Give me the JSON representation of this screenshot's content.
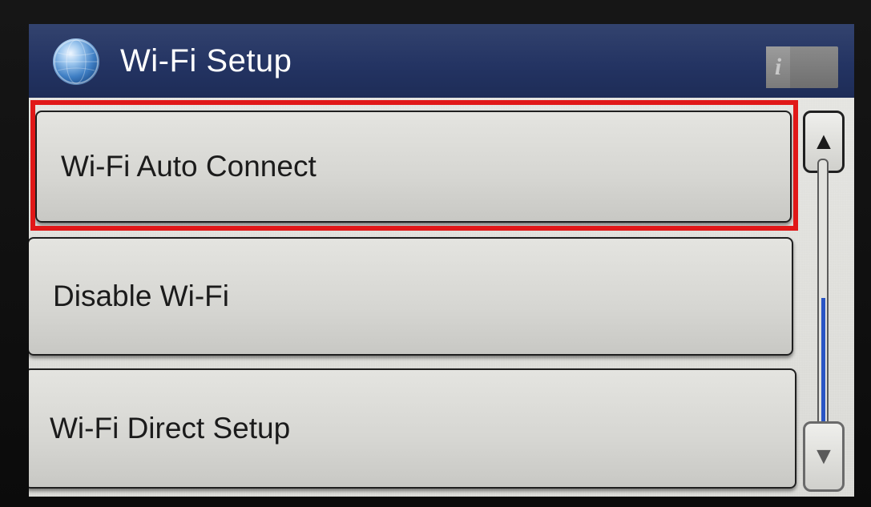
{
  "header": {
    "title": "Wi-Fi Setup",
    "globe_icon": "globe-icon",
    "info_label": "i"
  },
  "menu": {
    "items": [
      {
        "label": "Wi-Fi Auto Connect",
        "selected": true
      },
      {
        "label": "Disable Wi-Fi",
        "selected": false
      },
      {
        "label": "Wi-Fi Direct Setup",
        "selected": false
      }
    ]
  },
  "scrollbar": {
    "up_icon": "▲",
    "down_icon": "▼"
  },
  "colors": {
    "titlebar": "#243463",
    "highlight": "#e11818",
    "scroll_thumb": "#2a55c4"
  }
}
